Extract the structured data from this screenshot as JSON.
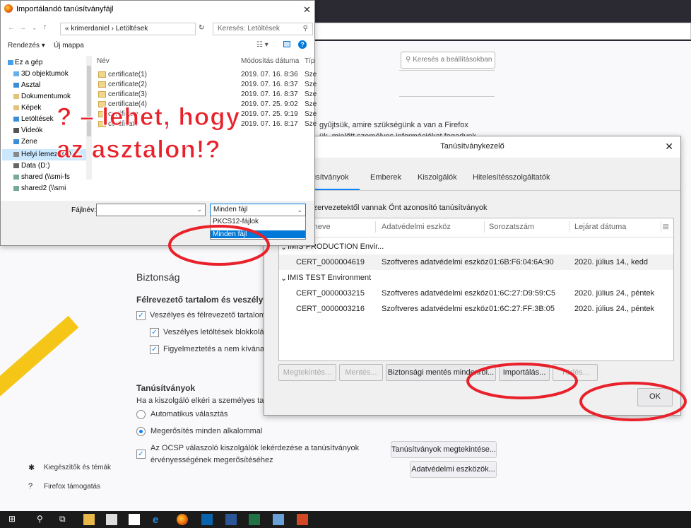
{
  "settings": {
    "search_placeholder": "Keresés a beállításokban",
    "privacy_text_1": "gyűjtsük, amire szükségünk a van a Firefox",
    "privacy_text_2": "ük, mielőtt személyes információkat fogadunk",
    "security_heading": "Biztonság",
    "deceptive_heading": "Félrevezető tartalom és veszélyes",
    "deceptive_items": [
      "Veszélyes és félrevezető tartalom b",
      "Veszélyes letöltések blokkolása",
      "Figyelmeztetés a nem kívánato"
    ],
    "certs_heading": "Tanúsítványok",
    "certs_desc": "Ha a kiszolgáló elkéri a személyes tanú",
    "radio_auto": "Automatikus választás",
    "radio_ask": "Megerősítés minden alkalommal",
    "ocsp_line1": "Az OCSP válaszoló kiszolgálók lekérdezése a tanúsítványok",
    "ocsp_line2": "érvényességének megerősítéséhez",
    "view_certs_button": "Tanúsítványok megtekintése...",
    "security_devices_button": "Adatvédelmi eszközök...",
    "sidebar_addons": "Kiegészítők és témák",
    "sidebar_support": "Firefox támogatás"
  },
  "cert_dialog": {
    "title": "Tanúsítványkezelő",
    "tabs": [
      "úsítványok",
      "Emberek",
      "Kiszolgálók",
      "Hitelesítésszolgáltatók"
    ],
    "description": "ő szervezetektől vannak Önt azonosító tanúsítványok",
    "columns": [
      "ány neve",
      "Adatvédelmi eszköz",
      "Sorozatszám",
      "Lejárat dátuma"
    ],
    "rows": [
      {
        "kind": "group",
        "name": "IMIS PRODUCTION Envir..."
      },
      {
        "kind": "cert",
        "name": "CERT_0000004619",
        "device": "Szoftveres adatvédelmi eszköz",
        "serial": "01:6B:F6:04:6A:90",
        "expiry": "2020. július 14., kedd"
      },
      {
        "kind": "group",
        "name": "IMIS TEST Environment"
      },
      {
        "kind": "cert",
        "name": "CERT_0000003215",
        "device": "Szoftveres adatvédelmi eszköz",
        "serial": "01:6C:27:D9:59:C5",
        "expiry": "2020. július 24., péntek"
      },
      {
        "kind": "cert",
        "name": "CERT_0000003216",
        "device": "Szoftveres adatvédelmi eszköz",
        "serial": "01:6C:27:FF:3B:05",
        "expiry": "2020. július 24., péntek"
      }
    ],
    "buttons": {
      "view": "Megtekintés...",
      "save": "Mentés...",
      "backup_all": "Biztonsági mentés mindenről...",
      "import": "Importálás...",
      "delete": "Törlés...",
      "ok": "OK"
    }
  },
  "file_dialog": {
    "title": "Importálandó tanúsítványfájl",
    "breadcrumb": "« krimerdaniel  ›  Letöltések",
    "search_placeholder": "Keresés: Letöltések",
    "toolbar": {
      "organize": "Rendezés ▾",
      "new_folder": "Új mappa"
    },
    "sidebar": [
      "Ez a gép",
      "3D objektumok",
      "Asztal",
      "Dokumentumok",
      "Képek",
      "Letöltések",
      "Videók",
      "Zene",
      "Helyi lemez (C:)",
      "Data (D:)",
      "shared (\\\\smi-fs",
      "shared2 (\\\\smi"
    ],
    "columns": {
      "name": "Név",
      "modified": "Módosítás dátuma",
      "type": "Típ"
    },
    "files": [
      {
        "name": "certificate(1)",
        "date": "2019. 07. 16. 8:36",
        "type": "Sze"
      },
      {
        "name": "certificate(2)",
        "date": "2019. 07. 16. 8:37",
        "type": "Sze"
      },
      {
        "name": "certificate(3)",
        "date": "2019. 07. 16. 8:37",
        "type": "Sze"
      },
      {
        "name": "certificate(4)",
        "date": "2019. 07. 25. 9:02",
        "type": "Sze"
      },
      {
        "name": "certificate",
        "date": "2019. 07. 25. 9:19",
        "type": "Sze"
      },
      {
        "name": "certificate",
        "date": "2019. 07. 16. 8:17",
        "type": "Sze"
      }
    ],
    "filename_label": "Fájlnév:",
    "filetype_selected": "Minden fájl",
    "filetype_options": [
      "PKCS12-fájlok",
      "Minden fájl"
    ]
  },
  "annotation": {
    "overlay_text": "? – lehet, hogy az asztalon!?",
    "circle_color": "#e8212a",
    "arrow_color": "#f5c518"
  }
}
